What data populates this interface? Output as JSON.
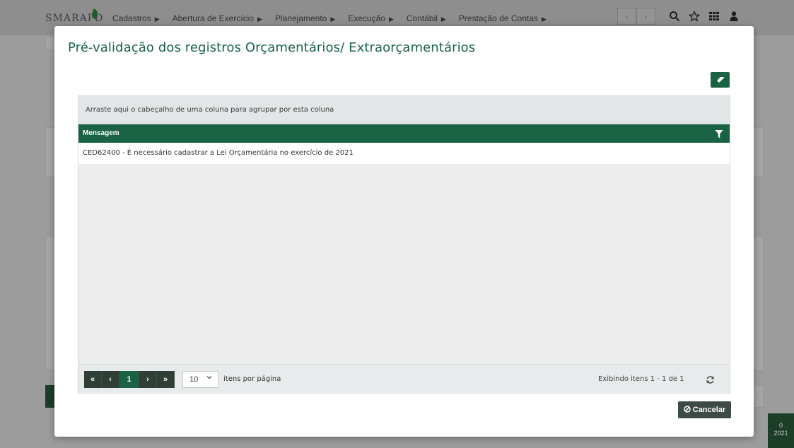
{
  "app": {
    "logo_text": "SMARAPD",
    "nav": [
      {
        "label": "Cadastros"
      },
      {
        "label": "Abertura de Exercício"
      },
      {
        "label": "Planejamento"
      },
      {
        "label": "Execução"
      },
      {
        "label": "Contábil"
      },
      {
        "label": "Prestação de Contas"
      }
    ],
    "nav_arrow_prev": "‹",
    "nav_arrow_next": "›",
    "icons": [
      "search-icon",
      "star-icon",
      "grid-icon",
      "user-icon"
    ],
    "side_counter": {
      "count": "0",
      "year": "2021"
    }
  },
  "modal": {
    "title": "Pré-validação dos registros Orçamentários/ Extraorçamentários",
    "group_panel_text": "Arraste aqui o cabeçalho de uma coluna para agrupar por esta coluna",
    "columns": [
      {
        "label": "Mensagem"
      }
    ],
    "rows": [
      {
        "mensagem": "CED62400 - É necessário cadastrar a Lei Orçamentária no exercício de 2021"
      }
    ],
    "pager": {
      "first": "«",
      "prev": "‹",
      "current_page": "1",
      "next": "›",
      "last": "»",
      "page_size": "10",
      "per_page_label": "itens por página",
      "info": "Exibindo itens 1 - 1 de 1"
    },
    "cancel_label": "Cancelar"
  },
  "colors": {
    "primary": "#196244",
    "dark_button": "#3e4a44",
    "pager_button": "#2f3f36"
  }
}
